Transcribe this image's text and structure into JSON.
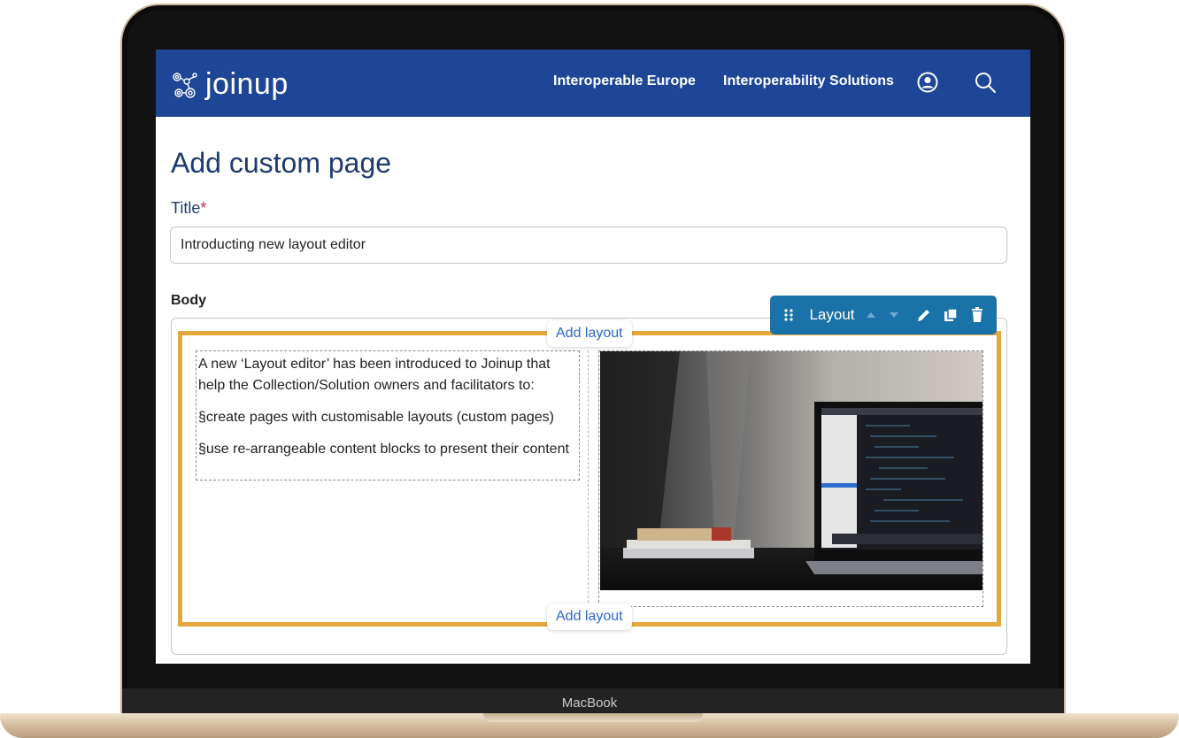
{
  "header": {
    "logo_text": "joinup",
    "nav": [
      "Interoperable Europe",
      "Interoperability Solutions"
    ]
  },
  "page": {
    "title": "Add custom page",
    "title_label": "Title",
    "required_mark": "*",
    "title_value": "Introducting new layout editor",
    "body_label": "Body"
  },
  "layout_toolbar": {
    "label": "Layout"
  },
  "add_layout_label": "Add layout",
  "content": {
    "paragraph": "A  new ‘Layout editor’ has been introduced to Joinup that help the Collection/Solution owners and facilitators to:",
    "bullets": [
      "§create pages with customisable layouts (custom pages)",
      "§use re-arrangeable content blocks to present their content"
    ]
  },
  "device_label": "MacBook",
  "colors": {
    "header_bg": "#1e4696",
    "title_text": "#1e3a6e",
    "layout_border": "#e4a83d",
    "toolbar_bg": "#1a73a8",
    "link_blue": "#2b67c6",
    "required_red": "#d0283c"
  }
}
